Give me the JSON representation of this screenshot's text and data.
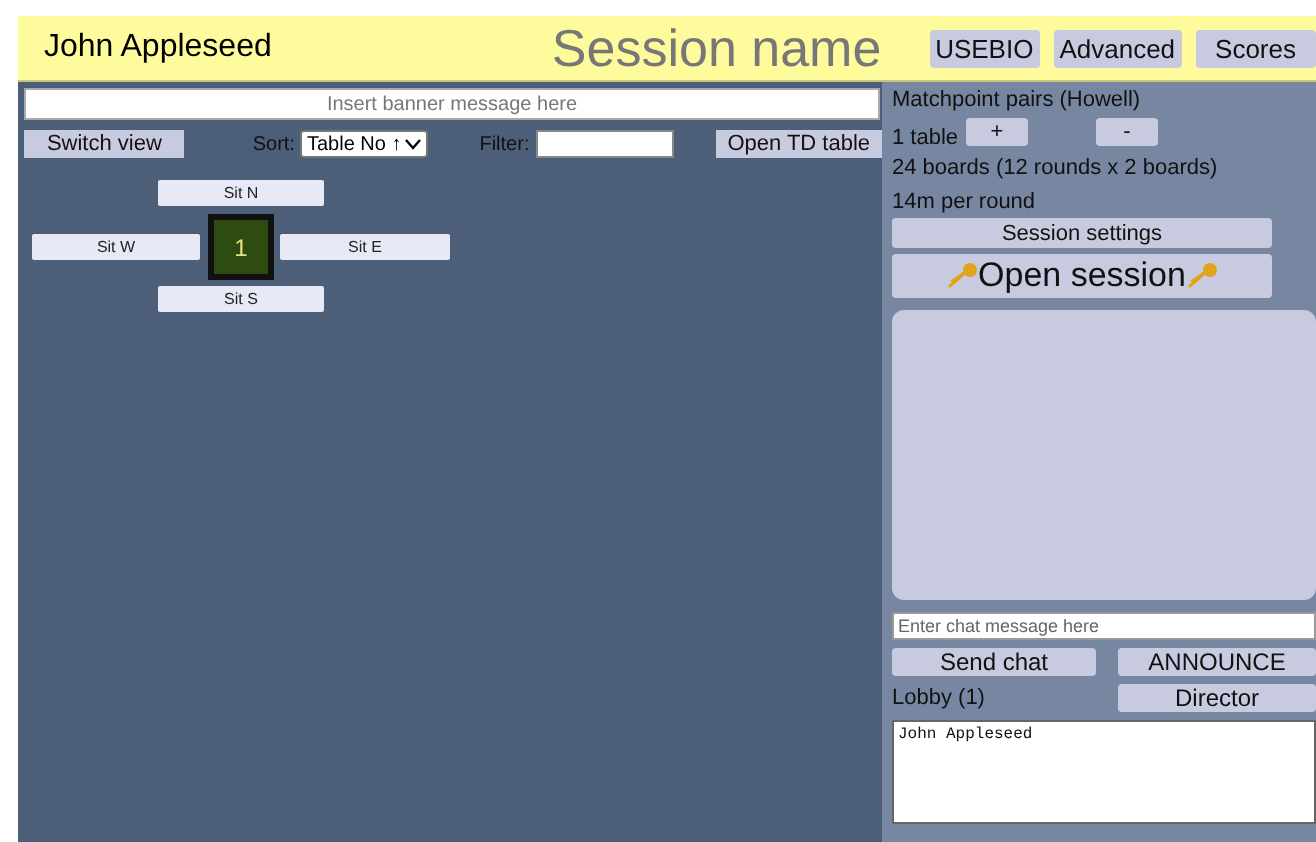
{
  "header": {
    "user": "John Appleseed",
    "title": "Session name",
    "buttons": [
      "USEBIO",
      "Advanced",
      "Scores"
    ]
  },
  "left": {
    "banner": {
      "placeholder": "Insert banner message here"
    },
    "switch_view": "Switch view",
    "sort_label": "Sort:",
    "sort_value": "Table No ↑",
    "filter_label": "Filter:",
    "open_td": "Open TD table",
    "tables": [
      {
        "number": "1",
        "north": "Sit N",
        "west": "Sit W",
        "east": "Sit E",
        "south": "Sit S"
      }
    ]
  },
  "right": {
    "movement": "Matchpoint pairs (Howell)",
    "tables": "1 table",
    "plus": "+",
    "minus": "-",
    "boards": "24 boards (12 rounds x 2 boards)",
    "timing": "14m per round",
    "session_settings": "Session settings",
    "open_session": "Open session",
    "chat": {
      "placeholder": "Enter chat message here"
    },
    "send_chat": "Send chat",
    "announce": "ANNOUNCE",
    "lobby": "Lobby (1)",
    "director": "Director",
    "lobby_users": [
      "John Appleseed"
    ]
  }
}
